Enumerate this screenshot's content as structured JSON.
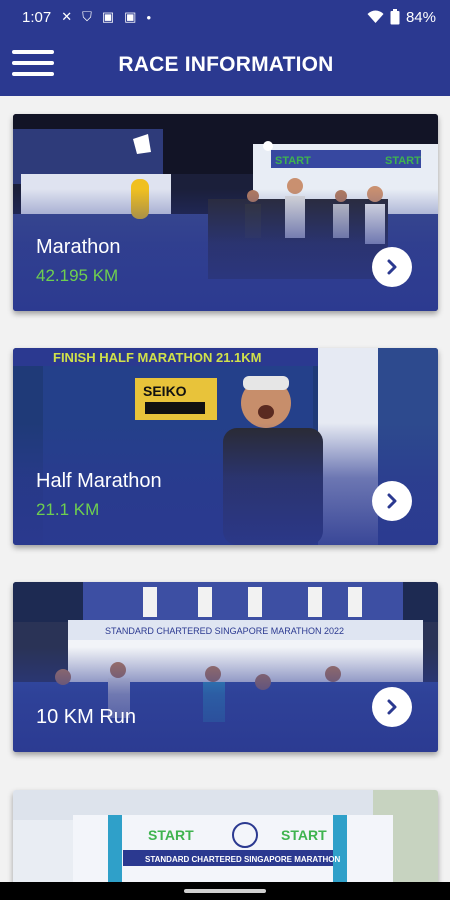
{
  "status": {
    "time": "1:07",
    "icons": [
      "tools-icon",
      "shield-icon",
      "teams-icon",
      "teams-icon",
      "dot"
    ],
    "battery": "84%"
  },
  "header": {
    "title": "RACE INFORMATION"
  },
  "races": [
    {
      "name": "Marathon",
      "distance": "42.195 KM"
    },
    {
      "name": "Half Marathon",
      "distance": "21.1 KM"
    },
    {
      "name": "10 KM Run",
      "distance": ""
    }
  ],
  "photo_text": {
    "start": "START",
    "finish": "FINISH HALF MARATHON 21.1KM",
    "seiko": "SEIKO",
    "banner_2022": "STANDARD CHARTERED SINGAPORE MARATHON 2022",
    "banner_scsm": "STANDARD CHARTERED SINGAPORE MARATHON"
  },
  "colors": {
    "brand": "#2b3990",
    "distance": "#6ecf4f"
  }
}
